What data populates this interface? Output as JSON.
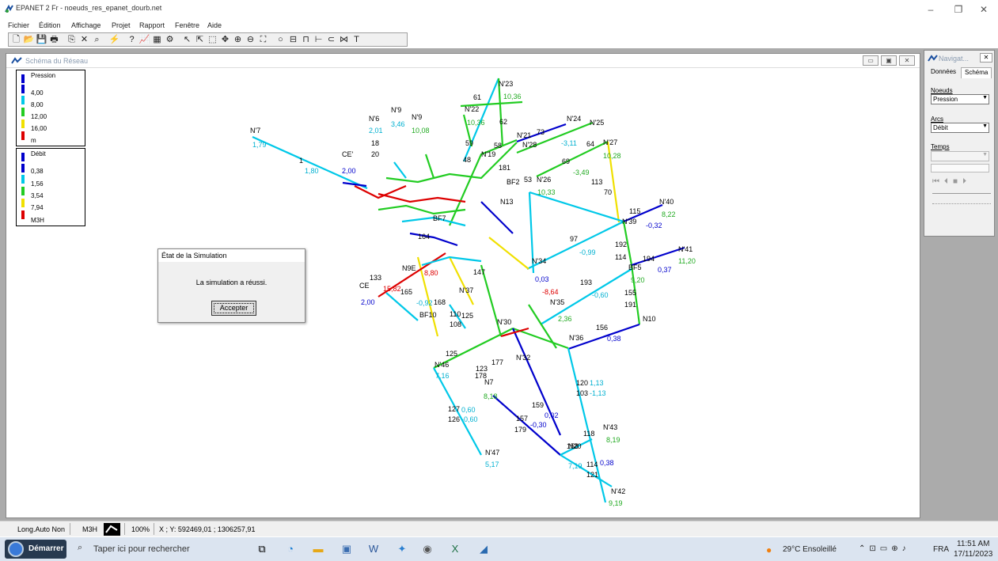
{
  "app": {
    "title": "EPANET 2 Fr - noeuds_res_epanet_dourb.net"
  },
  "menu": [
    "Fichier",
    "Édition",
    "Affichage",
    "Projet",
    "Rapport",
    "Fenêtre",
    "Aide"
  ],
  "map": {
    "title": "Schéma du Réseau",
    "legend_pression": {
      "title": "Pression",
      "items": [
        "4,00",
        "8,00",
        "12,00",
        "16,00"
      ],
      "unit": "m",
      "colors": [
        "#0000cc",
        "#00c8e8",
        "#22cc22",
        "#f0e000",
        "#dd0000"
      ]
    },
    "legend_debit": {
      "title": "Débit",
      "items": [
        "0,38",
        "1,56",
        "3,54",
        "7,94"
      ],
      "unit": "M3H",
      "colors": [
        "#0000cc",
        "#00c8e8",
        "#22cc22",
        "#f0e000",
        "#dd0000"
      ]
    },
    "node_labels": [
      "N'7",
      "N'6",
      "N'9",
      "N'23",
      "N'22",
      "N'21",
      "N'24",
      "N'25",
      "N'27",
      "N'19",
      "N'28",
      "N'26",
      "N'2",
      "N5",
      "N15",
      "N'3",
      "N'1",
      "N12",
      "N13",
      "N14",
      "N17",
      "N'17",
      "N16",
      "N3",
      "N2",
      "N11",
      "N1",
      "N18",
      "BF2",
      "BF7",
      "BF5",
      "N'40",
      "N'41",
      "N'39",
      "N'34",
      "N'33",
      "N'29",
      "N'37",
      "N'35",
      "N'31",
      "N'30",
      "N'38",
      "N45",
      "N'32",
      "N5",
      "N7",
      "N8",
      "N'36",
      "N10",
      "N'46",
      "BF10",
      "N9E",
      "N'47",
      "N'43",
      "N'44",
      "N20",
      "N'42",
      "CE'",
      "CE"
    ],
    "value_labels": [
      "1,79",
      "1,80",
      "2,00",
      "2,00",
      "3,46",
      "2,01",
      "10,08",
      "10,36",
      "10,36",
      "10,28",
      "8,22",
      "11,20",
      "9,20",
      "10,33",
      "5,17",
      "7,16",
      "9,19",
      "8,19",
      "8,18",
      "2,36",
      "-0,32",
      "0,37",
      "-0,99",
      "-0,60",
      "8,80",
      "15,82",
      "-0,92",
      "0,38",
      "0,38",
      "1,13",
      "-1,13",
      "-3,11",
      "-3,49",
      "0,03",
      "-8,64",
      "-0,30",
      "0,02",
      "0,60",
      "-0,60",
      "0,38",
      "7,19",
      "9,18"
    ],
    "pipe_labels": [
      "1",
      "97",
      "193",
      "156",
      "115",
      "192",
      "114",
      "194",
      "155",
      "191",
      "113",
      "70",
      "64",
      "69",
      "73",
      "62",
      "61",
      "59",
      "58",
      "53",
      "48",
      "181",
      "184",
      "187",
      "173",
      "169",
      "95",
      "90",
      "92",
      "99",
      "100",
      "104",
      "85",
      "84",
      "76",
      "108",
      "110",
      "107",
      "168",
      "109",
      "147",
      "125",
      "123",
      "177",
      "178",
      "159",
      "157",
      "179",
      "127",
      "126",
      "118",
      "158",
      "114",
      "121",
      "120",
      "103",
      "133",
      "165",
      "164",
      "20",
      "18",
      "17",
      "129",
      "132",
      "139",
      "140",
      "45",
      "42",
      "37",
      "40",
      "49",
      "71",
      "72",
      "74"
    ]
  },
  "navigator": {
    "title": "Navigat...",
    "tabs": [
      "Données",
      "Schéma"
    ],
    "noeuds_label": "Noeuds",
    "noeuds_value": "Pression",
    "arcs_label": "Arcs",
    "arcs_value": "Débit",
    "temps_label": "Temps"
  },
  "dialog": {
    "title": "État de la Simulation",
    "message": "La simulation a réussi.",
    "button": "Accepter"
  },
  "status": {
    "auto_length": "Long.Auto Non",
    "flow_units": "M3H",
    "zoom": "100%",
    "coords": "X ; Y: 592469,01 ; 1306257,91"
  },
  "taskbar": {
    "start": "Démarrer",
    "search_placeholder": "Taper ici pour rechercher",
    "weather": "29°C Ensoleillé",
    "lang": "FRA",
    "time": "11:51 AM",
    "date": "17/11/2023"
  }
}
